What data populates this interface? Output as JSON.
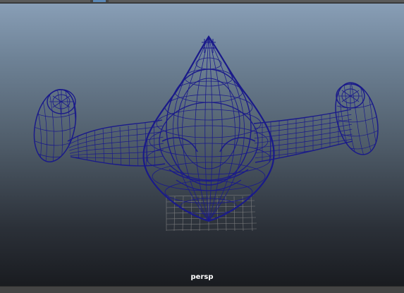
{
  "viewport": {
    "camera_name": "persp",
    "display_mode": "wireframe",
    "wire_color": "#1a1a8a",
    "grid_color": "#8a8a8a"
  }
}
